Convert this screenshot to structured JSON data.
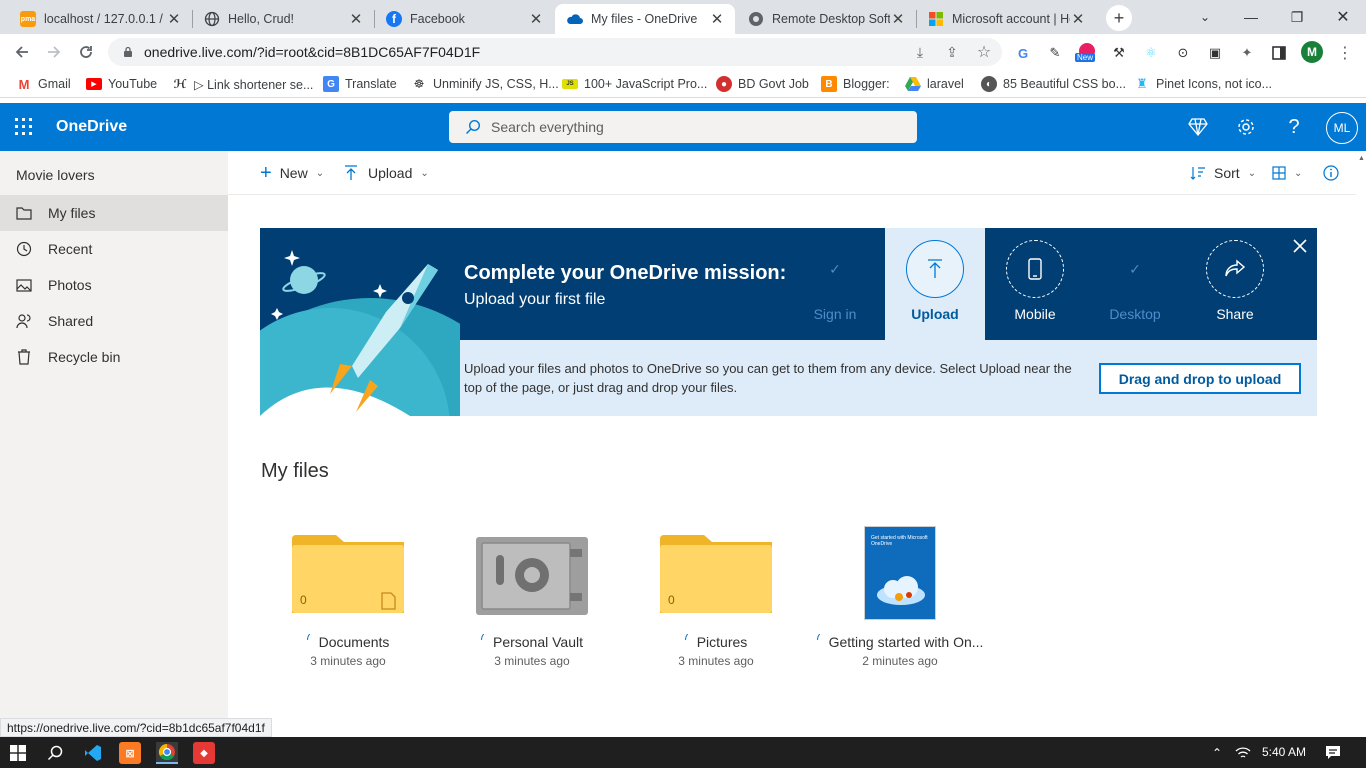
{
  "browser": {
    "tabs": [
      {
        "title": "localhost / 127.0.0.1 /",
        "icon": "phpmyadmin-icon"
      },
      {
        "title": "Hello, Crud!",
        "icon": "globe-icon"
      },
      {
        "title": "Facebook",
        "icon": "facebook-icon"
      },
      {
        "title": "My files - OneDrive",
        "icon": "onedrive-icon"
      },
      {
        "title": "Remote Desktop Softw",
        "icon": "remote-desktop-icon"
      },
      {
        "title": "Microsoft account | Ho",
        "icon": "microsoft-icon"
      }
    ],
    "url": "onedrive.live.com/?id=root&cid=8B1DC65AF7F04D1F",
    "profile_initial": "M",
    "new_badge": "New",
    "bookmarks": [
      {
        "label": "Gmail",
        "icon": "gmail-icon"
      },
      {
        "label": "YouTube",
        "icon": "youtube-icon"
      },
      {
        "label": "▷ Link shortener se...",
        "icon": "link-shortener-icon"
      },
      {
        "label": "Translate",
        "icon": "translate-icon"
      },
      {
        "label": "Unminify JS, CSS, H...",
        "icon": "unminify-icon"
      },
      {
        "label": "100+ JavaScript Pro...",
        "icon": "js-projects-icon"
      },
      {
        "label": "BD Govt Job",
        "icon": "bd-govt-icon"
      },
      {
        "label": "Blogger:",
        "icon": "blogger-icon"
      },
      {
        "label": "laravel",
        "icon": "google-drive-icon"
      },
      {
        "label": "85 Beautiful CSS bo...",
        "icon": "css-icon"
      },
      {
        "label": "Pinet Icons, not ico...",
        "icon": "pinet-icon"
      }
    ],
    "status_url": "https://onedrive.live.com/?cid=8b1dc65af7f04d1f"
  },
  "onedrive": {
    "app_name": "OneDrive",
    "search_placeholder": "Search everything",
    "avatar_initials": "ML",
    "brand_color": "#0078d4"
  },
  "nav": {
    "title": "Movie lovers",
    "items": [
      {
        "label": "My files",
        "icon": "folder-icon",
        "selected": true
      },
      {
        "label": "Recent",
        "icon": "history-icon"
      },
      {
        "label": "Photos",
        "icon": "photo-icon"
      },
      {
        "label": "Shared",
        "icon": "shared-icon"
      },
      {
        "label": "Recycle bin",
        "icon": "recycle-bin-icon"
      }
    ]
  },
  "commands": {
    "new": "New",
    "upload": "Upload",
    "sort": "Sort"
  },
  "banner": {
    "title": "Complete your OneDrive mission:",
    "subtitle": "Upload your first file",
    "steps": [
      {
        "label": "Sign in",
        "state": "done"
      },
      {
        "label": "Upload",
        "state": "active"
      },
      {
        "label": "Mobile",
        "state": "todo"
      },
      {
        "label": "Desktop",
        "state": "done"
      },
      {
        "label": "Share",
        "state": "todo"
      }
    ],
    "description": "Upload your files and photos to OneDrive so you can get to them from any device. Select Upload near the top of the page, or just drag and drop your files.",
    "drag_button": "Drag and drop to upload"
  },
  "files": {
    "heading": "My files",
    "items": [
      {
        "name": "Documents",
        "time": "3 minutes ago",
        "count": "0",
        "kind": "folder"
      },
      {
        "name": "Personal Vault",
        "time": "3 minutes ago",
        "kind": "vault"
      },
      {
        "name": "Pictures",
        "time": "3 minutes ago",
        "count": "0",
        "kind": "folder"
      },
      {
        "name": "Getting started with On...",
        "time": "2 minutes ago",
        "kind": "document",
        "thumb_text": "Get started with Microsoft OneDrive"
      }
    ]
  },
  "taskbar": {
    "time": "5:40 AM"
  }
}
